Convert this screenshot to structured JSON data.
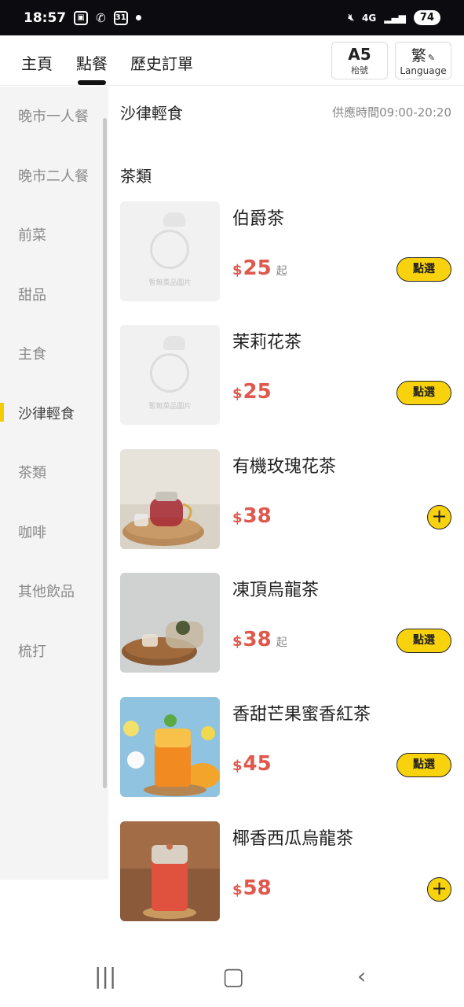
{
  "status_bar": {
    "time": "18:57",
    "network": "4G",
    "battery": "74"
  },
  "nav": {
    "tabs": [
      "主頁",
      "點餐",
      "歷史訂單"
    ],
    "table": {
      "number": "A5",
      "label": "枱號"
    },
    "language": {
      "glyph": "繁",
      "label": "Language"
    }
  },
  "sidebar": {
    "categories": [
      "晚市一人餐",
      "晚市二人餐",
      "前菜",
      "甜品",
      "主食",
      "沙律輕食",
      "茶類",
      "咖啡",
      "其他飲品",
      "梳打"
    ],
    "active": "沙律輕食"
  },
  "content": {
    "section_title": "沙律輕食",
    "hours": "供應時間09:00-20:20",
    "sub_title": "茶類",
    "currency": "$",
    "placeholder_text": "暫無菜品圖片",
    "items": [
      {
        "name": "伯爵茶",
        "price": "25",
        "suffix": "起",
        "action": "點選",
        "image": "placeholder"
      },
      {
        "name": "茉莉花茶",
        "price": "25",
        "suffix": "",
        "action": "點選",
        "image": "placeholder"
      },
      {
        "name": "有機玫瑰花茶",
        "price": "38",
        "suffix": "",
        "action": "+",
        "image": "rose-tea-photo"
      },
      {
        "name": "凍頂烏龍茶",
        "price": "38",
        "suffix": "起",
        "action": "點選",
        "image": "oolong-tea-photo"
      },
      {
        "name": "香甜芒果蜜香紅茶",
        "price": "45",
        "suffix": "",
        "action": "點選",
        "image": "mango-tea-photo"
      },
      {
        "name": "椰香西瓜烏龍茶",
        "price": "58",
        "suffix": "",
        "action": "+",
        "image": "watermelon-tea-photo"
      }
    ]
  },
  "colors": {
    "accent": "#f8d20d",
    "price": "#e0584c",
    "sidebar_bg": "#f4f4f4",
    "status_bar": "#0b0b10"
  }
}
